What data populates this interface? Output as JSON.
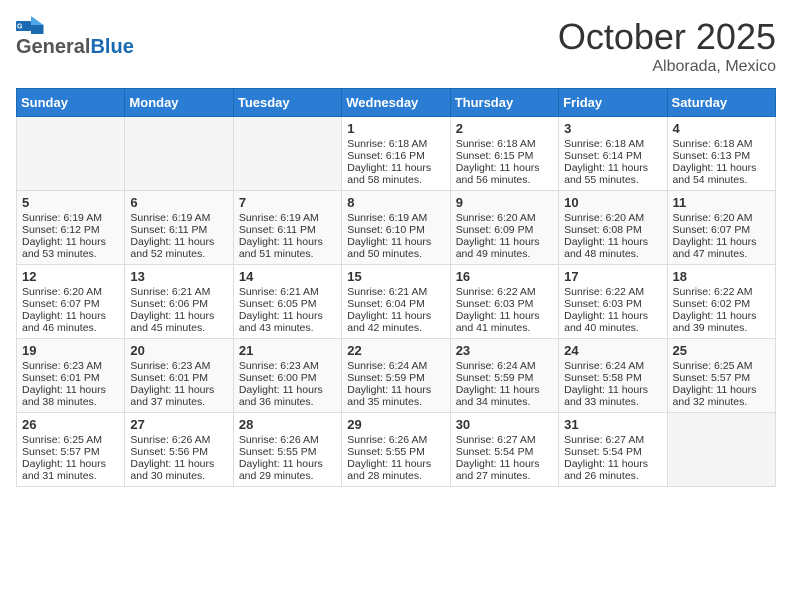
{
  "header": {
    "logo_general": "General",
    "logo_blue": "Blue",
    "month": "October 2025",
    "location": "Alborada, Mexico"
  },
  "weekdays": [
    "Sunday",
    "Monday",
    "Tuesday",
    "Wednesday",
    "Thursday",
    "Friday",
    "Saturday"
  ],
  "weeks": [
    [
      {
        "day": "",
        "sunrise": "",
        "sunset": "",
        "daylight": ""
      },
      {
        "day": "",
        "sunrise": "",
        "sunset": "",
        "daylight": ""
      },
      {
        "day": "",
        "sunrise": "",
        "sunset": "",
        "daylight": ""
      },
      {
        "day": "1",
        "sunrise": "Sunrise: 6:18 AM",
        "sunset": "Sunset: 6:16 PM",
        "daylight": "Daylight: 11 hours and 58 minutes."
      },
      {
        "day": "2",
        "sunrise": "Sunrise: 6:18 AM",
        "sunset": "Sunset: 6:15 PM",
        "daylight": "Daylight: 11 hours and 56 minutes."
      },
      {
        "day": "3",
        "sunrise": "Sunrise: 6:18 AM",
        "sunset": "Sunset: 6:14 PM",
        "daylight": "Daylight: 11 hours and 55 minutes."
      },
      {
        "day": "4",
        "sunrise": "Sunrise: 6:18 AM",
        "sunset": "Sunset: 6:13 PM",
        "daylight": "Daylight: 11 hours and 54 minutes."
      }
    ],
    [
      {
        "day": "5",
        "sunrise": "Sunrise: 6:19 AM",
        "sunset": "Sunset: 6:12 PM",
        "daylight": "Daylight: 11 hours and 53 minutes."
      },
      {
        "day": "6",
        "sunrise": "Sunrise: 6:19 AM",
        "sunset": "Sunset: 6:11 PM",
        "daylight": "Daylight: 11 hours and 52 minutes."
      },
      {
        "day": "7",
        "sunrise": "Sunrise: 6:19 AM",
        "sunset": "Sunset: 6:11 PM",
        "daylight": "Daylight: 11 hours and 51 minutes."
      },
      {
        "day": "8",
        "sunrise": "Sunrise: 6:19 AM",
        "sunset": "Sunset: 6:10 PM",
        "daylight": "Daylight: 11 hours and 50 minutes."
      },
      {
        "day": "9",
        "sunrise": "Sunrise: 6:20 AM",
        "sunset": "Sunset: 6:09 PM",
        "daylight": "Daylight: 11 hours and 49 minutes."
      },
      {
        "day": "10",
        "sunrise": "Sunrise: 6:20 AM",
        "sunset": "Sunset: 6:08 PM",
        "daylight": "Daylight: 11 hours and 48 minutes."
      },
      {
        "day": "11",
        "sunrise": "Sunrise: 6:20 AM",
        "sunset": "Sunset: 6:07 PM",
        "daylight": "Daylight: 11 hours and 47 minutes."
      }
    ],
    [
      {
        "day": "12",
        "sunrise": "Sunrise: 6:20 AM",
        "sunset": "Sunset: 6:07 PM",
        "daylight": "Daylight: 11 hours and 46 minutes."
      },
      {
        "day": "13",
        "sunrise": "Sunrise: 6:21 AM",
        "sunset": "Sunset: 6:06 PM",
        "daylight": "Daylight: 11 hours and 45 minutes."
      },
      {
        "day": "14",
        "sunrise": "Sunrise: 6:21 AM",
        "sunset": "Sunset: 6:05 PM",
        "daylight": "Daylight: 11 hours and 43 minutes."
      },
      {
        "day": "15",
        "sunrise": "Sunrise: 6:21 AM",
        "sunset": "Sunset: 6:04 PM",
        "daylight": "Daylight: 11 hours and 42 minutes."
      },
      {
        "day": "16",
        "sunrise": "Sunrise: 6:22 AM",
        "sunset": "Sunset: 6:03 PM",
        "daylight": "Daylight: 11 hours and 41 minutes."
      },
      {
        "day": "17",
        "sunrise": "Sunrise: 6:22 AM",
        "sunset": "Sunset: 6:03 PM",
        "daylight": "Daylight: 11 hours and 40 minutes."
      },
      {
        "day": "18",
        "sunrise": "Sunrise: 6:22 AM",
        "sunset": "Sunset: 6:02 PM",
        "daylight": "Daylight: 11 hours and 39 minutes."
      }
    ],
    [
      {
        "day": "19",
        "sunrise": "Sunrise: 6:23 AM",
        "sunset": "Sunset: 6:01 PM",
        "daylight": "Daylight: 11 hours and 38 minutes."
      },
      {
        "day": "20",
        "sunrise": "Sunrise: 6:23 AM",
        "sunset": "Sunset: 6:01 PM",
        "daylight": "Daylight: 11 hours and 37 minutes."
      },
      {
        "day": "21",
        "sunrise": "Sunrise: 6:23 AM",
        "sunset": "Sunset: 6:00 PM",
        "daylight": "Daylight: 11 hours and 36 minutes."
      },
      {
        "day": "22",
        "sunrise": "Sunrise: 6:24 AM",
        "sunset": "Sunset: 5:59 PM",
        "daylight": "Daylight: 11 hours and 35 minutes."
      },
      {
        "day": "23",
        "sunrise": "Sunrise: 6:24 AM",
        "sunset": "Sunset: 5:59 PM",
        "daylight": "Daylight: 11 hours and 34 minutes."
      },
      {
        "day": "24",
        "sunrise": "Sunrise: 6:24 AM",
        "sunset": "Sunset: 5:58 PM",
        "daylight": "Daylight: 11 hours and 33 minutes."
      },
      {
        "day": "25",
        "sunrise": "Sunrise: 6:25 AM",
        "sunset": "Sunset: 5:57 PM",
        "daylight": "Daylight: 11 hours and 32 minutes."
      }
    ],
    [
      {
        "day": "26",
        "sunrise": "Sunrise: 6:25 AM",
        "sunset": "Sunset: 5:57 PM",
        "daylight": "Daylight: 11 hours and 31 minutes."
      },
      {
        "day": "27",
        "sunrise": "Sunrise: 6:26 AM",
        "sunset": "Sunset: 5:56 PM",
        "daylight": "Daylight: 11 hours and 30 minutes."
      },
      {
        "day": "28",
        "sunrise": "Sunrise: 6:26 AM",
        "sunset": "Sunset: 5:55 PM",
        "daylight": "Daylight: 11 hours and 29 minutes."
      },
      {
        "day": "29",
        "sunrise": "Sunrise: 6:26 AM",
        "sunset": "Sunset: 5:55 PM",
        "daylight": "Daylight: 11 hours and 28 minutes."
      },
      {
        "day": "30",
        "sunrise": "Sunrise: 6:27 AM",
        "sunset": "Sunset: 5:54 PM",
        "daylight": "Daylight: 11 hours and 27 minutes."
      },
      {
        "day": "31",
        "sunrise": "Sunrise: 6:27 AM",
        "sunset": "Sunset: 5:54 PM",
        "daylight": "Daylight: 11 hours and 26 minutes."
      },
      {
        "day": "",
        "sunrise": "",
        "sunset": "",
        "daylight": ""
      }
    ]
  ]
}
